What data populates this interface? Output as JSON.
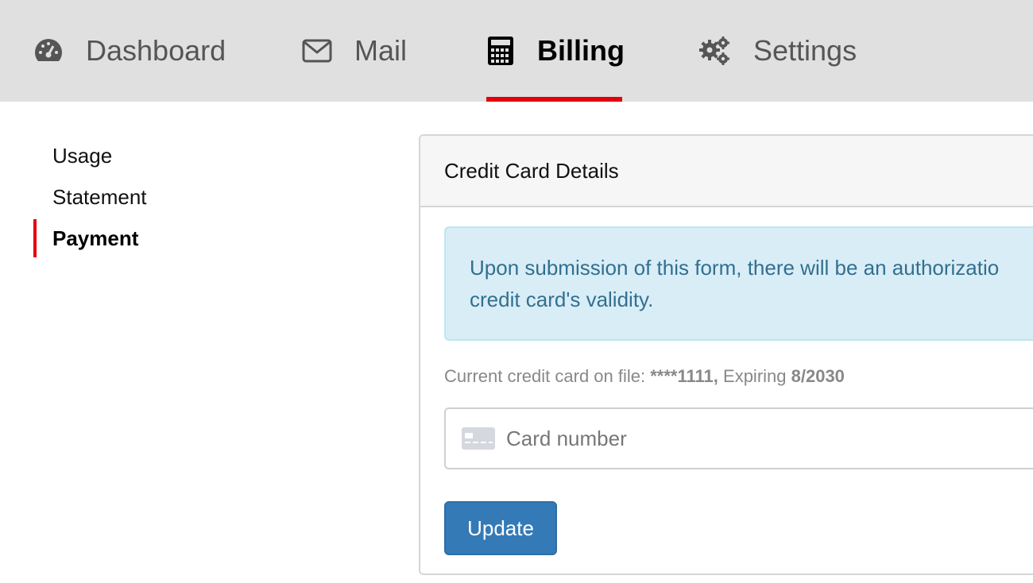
{
  "nav": {
    "items": [
      {
        "label": "Dashboard",
        "icon": "dashboard-gauge-icon"
      },
      {
        "label": "Mail",
        "icon": "envelope-icon"
      },
      {
        "label": "Billing",
        "icon": "calculator-icon",
        "active": true
      },
      {
        "label": "Settings",
        "icon": "gears-icon"
      }
    ],
    "accent_color": "#e3000f"
  },
  "sidebar": {
    "items": [
      {
        "label": "Usage"
      },
      {
        "label": "Statement"
      },
      {
        "label": "Payment",
        "active": true
      }
    ]
  },
  "panel": {
    "title": "Credit Card Details",
    "alert_line1": "Upon submission of this form, there will be an authorizatio",
    "alert_line2": "credit card's validity.",
    "card_on_file": {
      "prefix": "Current credit card on file: ",
      "masked_number": "****1111,",
      "expiring_label": " Expiring ",
      "expiry": "8/2030"
    },
    "card_input": {
      "placeholder": "Card number",
      "value": ""
    },
    "submit_label": "Update"
  }
}
